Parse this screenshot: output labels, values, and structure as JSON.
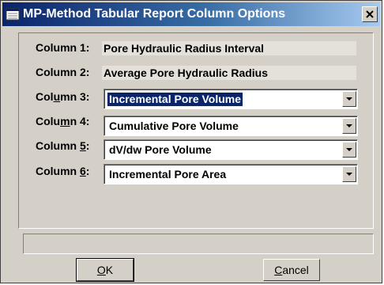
{
  "window": {
    "title": "MP-Method Tabular Report Column Options",
    "close_icon": "close-icon",
    "app_icon": "window-app-icon"
  },
  "columns": [
    {
      "label_pre": "Column 1:",
      "label_hot": "",
      "label_post": "",
      "value": "Pore Hydraulic Radius Interval",
      "type": "static"
    },
    {
      "label_pre": "Column 2:",
      "label_hot": "",
      "label_post": "",
      "value": "Average Pore Hydraulic Radius",
      "type": "static"
    },
    {
      "label_pre": "Col",
      "label_hot": "u",
      "label_post": "mn 3:",
      "value": "Incremental Pore Volume",
      "type": "dropdown",
      "focused": true
    },
    {
      "label_pre": "Colu",
      "label_hot": "m",
      "label_post": "n 4:",
      "value": "Cumulative Pore Volume",
      "type": "dropdown"
    },
    {
      "label_pre": "Column ",
      "label_hot": "5",
      "label_post": ":",
      "value": "dV/dw Pore Volume",
      "type": "dropdown"
    },
    {
      "label_pre": "Column ",
      "label_hot": "6",
      "label_post": ":",
      "value": "Incremental Pore Area",
      "type": "dropdown"
    }
  ],
  "buttons": {
    "ok": {
      "hot": "O",
      "rest": "K"
    },
    "cancel": {
      "hot": "C",
      "rest": "ancel"
    }
  },
  "colors": {
    "title_start": "#0a246a",
    "title_end": "#a6caf0",
    "face": "#d4d0c8",
    "selection": "#0a246a"
  }
}
